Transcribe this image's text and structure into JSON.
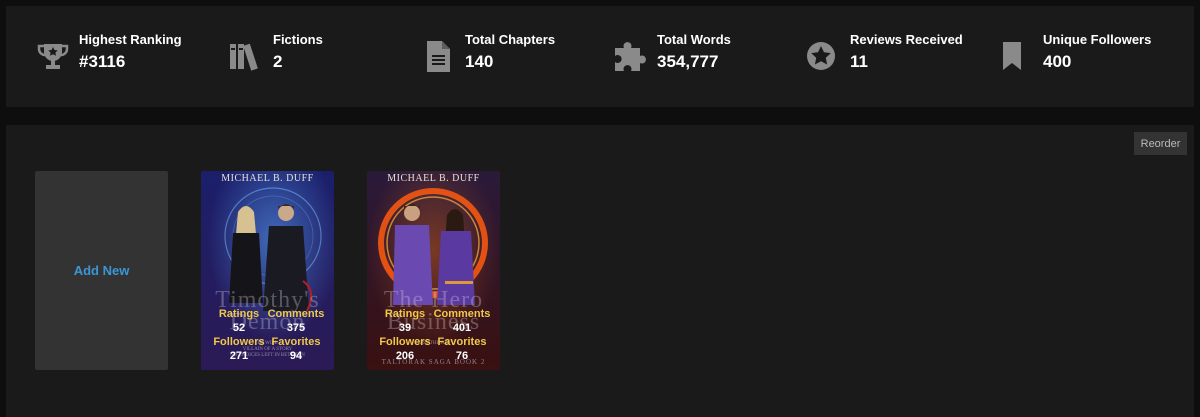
{
  "stats": [
    {
      "icon": "trophy-icon",
      "label": "Highest Ranking",
      "value": "#3116"
    },
    {
      "icon": "books-icon",
      "label": "Fictions",
      "value": "2"
    },
    {
      "icon": "document-icon",
      "label": "Total Chapters",
      "value": "140"
    },
    {
      "icon": "puzzle-icon",
      "label": "Total Words",
      "value": "354,777"
    },
    {
      "icon": "star-icon",
      "label": "Reviews Received",
      "value": "11"
    },
    {
      "icon": "bookmark-icon",
      "label": "Unique Followers",
      "value": "400"
    }
  ],
  "works": {
    "reorder_label": "Reorder",
    "add_new_label": "Add New",
    "overlay_labels": {
      "ratings": "Ratings",
      "comments": "Comments",
      "followers": "Followers",
      "favorites": "Favorites"
    },
    "fictions": [
      {
        "author": "MICHAEL B. DUFF",
        "title_line1": "Timothy's",
        "title_line2": "Demon",
        "subtitle_line1": "HE WILL",
        "subtitle_line2": "VILLAIN OF A STORY",
        "subtitle_line3": "NO CHOICES LEFT IN BETWEEN",
        "series": "",
        "ratings": "52",
        "comments": "375",
        "followers": "271",
        "favorites": "94",
        "theme": {
          "bg_top": "#1b1f6b",
          "bg_bottom": "#2b1a55",
          "glow": "#5aa8ff"
        }
      },
      {
        "author": "MICHAEL B. DUFF",
        "title_line1": "The Hero",
        "title_line2": "Business",
        "subtitle_line1": "JUST THE JOB",
        "subtitle_line2": "",
        "subtitle_line3": "",
        "series": "TALTORAK SAGA BOOK 2",
        "ratings": "39",
        "comments": "401",
        "followers": "206",
        "favorites": "76",
        "theme": {
          "bg_top": "#2a1a3a",
          "bg_bottom": "#3a1010",
          "glow": "#ff7a1a"
        }
      }
    ]
  }
}
